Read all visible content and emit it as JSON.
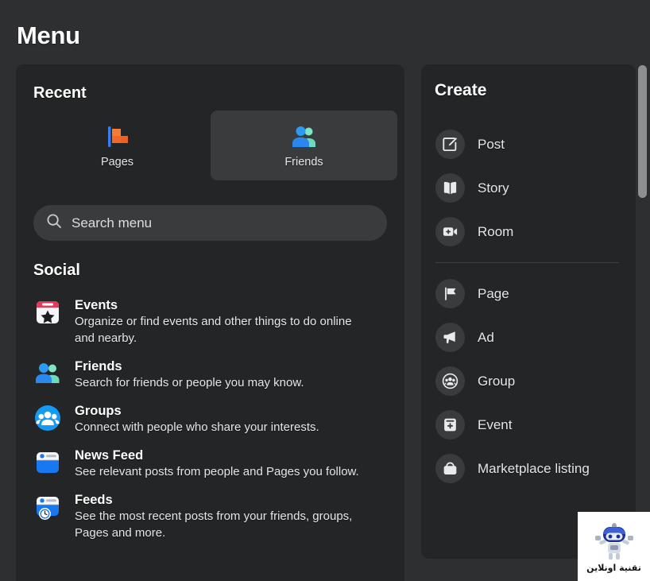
{
  "page": {
    "title": "Menu",
    "background_color": "#2e2f30",
    "card_color": "#242526",
    "accent_color": "#3a3b3c"
  },
  "recent": {
    "heading": "Recent",
    "tiles": [
      {
        "label": "Pages",
        "icon": "pages-flag-icon",
        "active": false
      },
      {
        "label": "Friends",
        "icon": "friends-people-icon",
        "active": true
      }
    ]
  },
  "search": {
    "placeholder": "Search menu",
    "value": "",
    "icon": "search-icon"
  },
  "social": {
    "heading": "Social",
    "items": [
      {
        "title": "Events",
        "desc": "Organize or find events and other things to do online and nearby.",
        "icon": "events-calendar-star-icon"
      },
      {
        "title": "Friends",
        "desc": "Search for friends or people you may know.",
        "icon": "friends-people-icon"
      },
      {
        "title": "Groups",
        "desc": "Connect with people who share your interests.",
        "icon": "groups-circle-icon"
      },
      {
        "title": "News Feed",
        "desc": "See relevant posts from people and Pages you follow.",
        "icon": "news-feed-icon"
      },
      {
        "title": "Feeds",
        "desc": "See the most recent posts from your friends, groups, Pages and more.",
        "icon": "feeds-clock-icon"
      }
    ]
  },
  "create": {
    "heading": "Create",
    "group_one": [
      {
        "label": "Post",
        "icon": "compose-pencil-icon"
      },
      {
        "label": "Story",
        "icon": "open-book-icon"
      },
      {
        "label": "Room",
        "icon": "video-camera-plus-icon"
      }
    ],
    "group_two": [
      {
        "label": "Page",
        "icon": "flag-icon"
      },
      {
        "label": "Ad",
        "icon": "megaphone-icon"
      },
      {
        "label": "Group",
        "icon": "group-people-icon"
      },
      {
        "label": "Event",
        "icon": "event-plus-icon"
      },
      {
        "label": "Marketplace listing",
        "icon": "shopping-bag-icon"
      }
    ]
  },
  "scrollbar": {
    "name": "vertical-scrollbar"
  },
  "watermark": {
    "text": "تقنية اونلاين"
  }
}
